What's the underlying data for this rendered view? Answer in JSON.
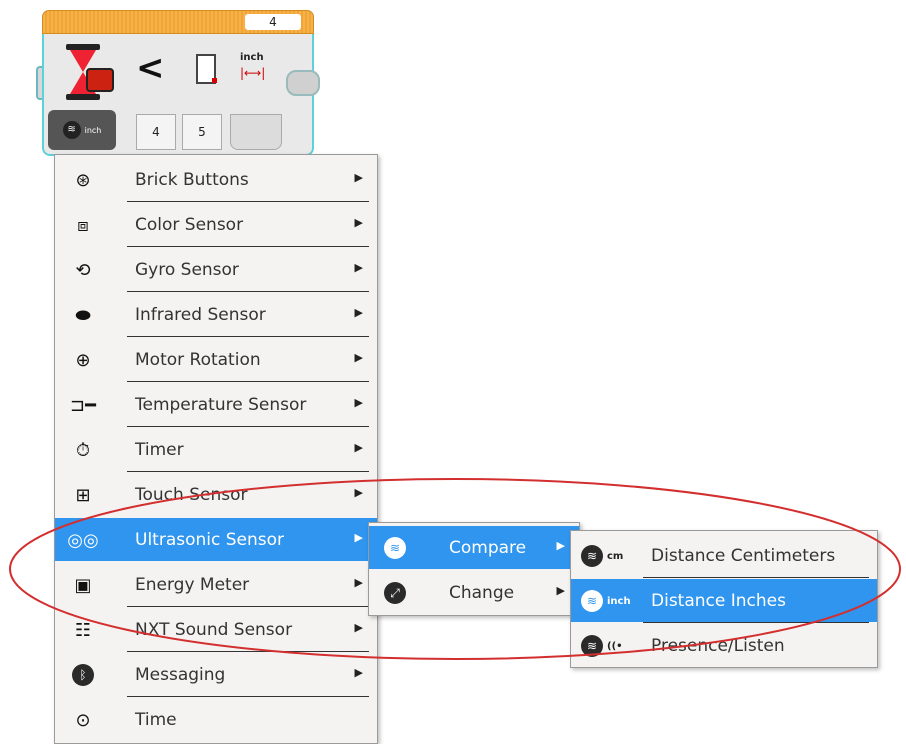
{
  "block": {
    "top_value": "4",
    "comparison_symbol": "<",
    "unit_label": "inch",
    "mode_unit_label": "inch",
    "input_values": [
      "4",
      "5"
    ]
  },
  "main_menu": {
    "items": [
      {
        "label": "Brick Buttons",
        "icon": "brick-buttons-icon",
        "has_submenu": true
      },
      {
        "label": "Color Sensor",
        "icon": "color-sensor-icon",
        "has_submenu": true
      },
      {
        "label": "Gyro Sensor",
        "icon": "gyro-sensor-icon",
        "has_submenu": true
      },
      {
        "label": "Infrared Sensor",
        "icon": "infrared-sensor-icon",
        "has_submenu": true
      },
      {
        "label": "Motor Rotation",
        "icon": "motor-rotation-icon",
        "has_submenu": true
      },
      {
        "label": "Temperature Sensor",
        "icon": "temperature-sensor-icon",
        "has_submenu": true
      },
      {
        "label": "Timer",
        "icon": "timer-icon",
        "has_submenu": true
      },
      {
        "label": "Touch Sensor",
        "icon": "touch-sensor-icon",
        "has_submenu": true
      },
      {
        "label": "Ultrasonic Sensor",
        "icon": "ultrasonic-sensor-icon",
        "has_submenu": true,
        "selected": true
      },
      {
        "label": "Energy Meter",
        "icon": "energy-meter-icon",
        "has_submenu": true
      },
      {
        "label": "NXT Sound Sensor",
        "icon": "nxt-sound-sensor-icon",
        "has_submenu": true
      },
      {
        "label": "Messaging",
        "icon": "bluetooth-icon",
        "has_submenu": true
      },
      {
        "label": "Time",
        "icon": "stopwatch-icon",
        "has_submenu": false
      }
    ]
  },
  "sub_menu": {
    "items": [
      {
        "label": "Compare",
        "icon": "ultrasonic-compare-icon",
        "selected": true
      },
      {
        "label": "Change",
        "icon": "change-icon"
      }
    ]
  },
  "sub2_menu": {
    "items": [
      {
        "label": "Distance Centimeters",
        "tag": "cm"
      },
      {
        "label": "Distance Inches",
        "tag": "inch",
        "selected": true
      },
      {
        "label": "Presence/Listen",
        "tag": "((•"
      }
    ]
  },
  "colors": {
    "selection": "#2f95ee",
    "annotation": "#d32f2f",
    "block_border": "#5ed0da",
    "block_header": "#f2a535"
  }
}
